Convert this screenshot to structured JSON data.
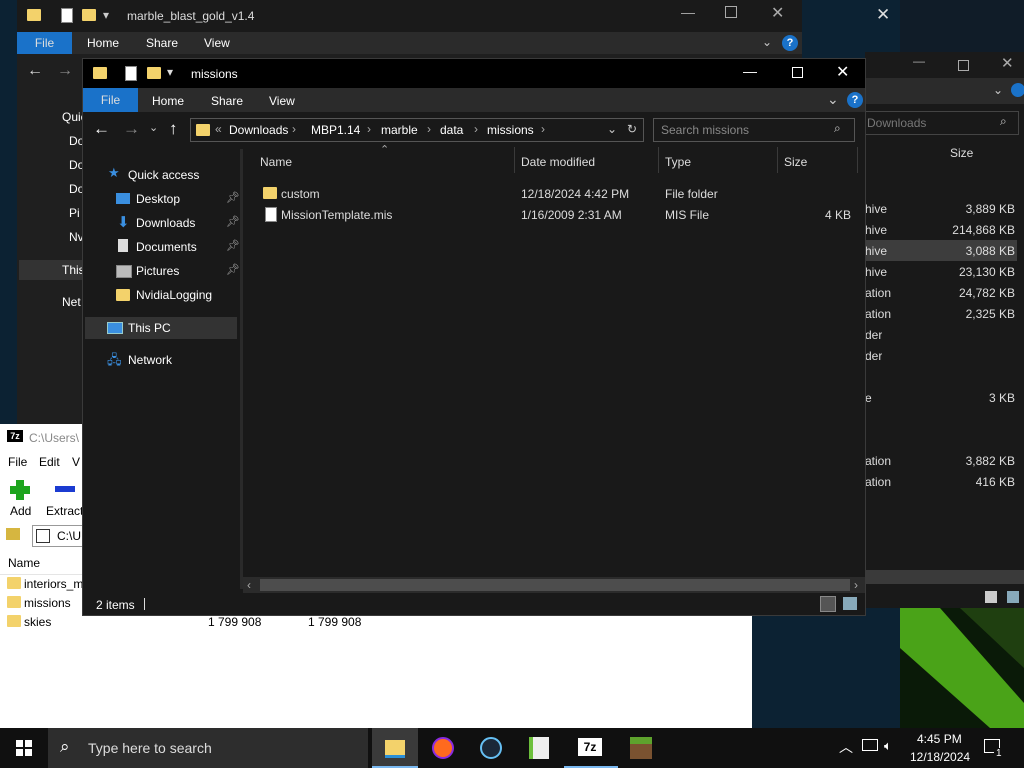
{
  "bg_explorer": {
    "title": "marble_blast_gold_v1.4",
    "ribbon": [
      "File",
      "Home",
      "Share",
      "View"
    ],
    "nav_partial": [
      "Quic",
      "Do",
      "Do",
      "Do",
      "Pi",
      "Nv",
      "This",
      "Net"
    ]
  },
  "right_explorer": {
    "search_placeholder": "Downloads",
    "size_header": "Size",
    "rows": [
      {
        "type": "hive",
        "size": "3,889 KB"
      },
      {
        "type": "hive",
        "size": "214,868 KB"
      },
      {
        "type": "hive",
        "size": "3,088 KB",
        "selected": true
      },
      {
        "type": "hive",
        "size": "23,130 KB"
      },
      {
        "type": "ation",
        "size": "24,782 KB"
      },
      {
        "type": "ation",
        "size": "2,325 KB"
      },
      {
        "type": "der",
        "size": ""
      },
      {
        "type": "der",
        "size": ""
      },
      {
        "type": "",
        "size": ""
      },
      {
        "type": "e",
        "size": "3 KB"
      },
      {
        "type": "",
        "size": ""
      },
      {
        "type": "",
        "size": ""
      },
      {
        "type": "ation",
        "size": "3,882 KB"
      },
      {
        "type": "ation",
        "size": "416 KB"
      }
    ]
  },
  "sevenzip": {
    "title": "C:\\Users\\",
    "menu": [
      "File",
      "Edit",
      "V"
    ],
    "add_label": "Add",
    "extract_label": "Extract",
    "path_partial": "C:\\U",
    "name_header": "Name",
    "rows": [
      {
        "name": "interiors_m",
        "size": "",
        "packed": ""
      },
      {
        "name": "missions",
        "size": "",
        "packed": ""
      },
      {
        "name": "skies",
        "size": "1 799 908",
        "packed": "1 799 908"
      }
    ]
  },
  "explorer": {
    "title": "missions",
    "ribbon": {
      "file": "File",
      "home": "Home",
      "share": "Share",
      "view": "View"
    },
    "breadcrumb": [
      "Downloads",
      "MBP1.14",
      "marble",
      "data",
      "missions"
    ],
    "search_placeholder": "Search missions",
    "nav": {
      "quick_access": "Quick access",
      "pinned": [
        "Desktop",
        "Downloads",
        "Documents",
        "Pictures"
      ],
      "nvidia": "NvidiaLogging",
      "this_pc": "This PC",
      "network": "Network"
    },
    "columns": {
      "name": "Name",
      "date": "Date modified",
      "type": "Type",
      "size": "Size"
    },
    "files": [
      {
        "name": "custom",
        "date": "12/18/2024 4:42 PM",
        "type": "File folder",
        "size": "",
        "icon": "folder-icon"
      },
      {
        "name": "MissionTemplate.mis",
        "date": "1/16/2009 2:31 AM",
        "type": "MIS File",
        "size": "4 KB",
        "icon": "file-icon"
      }
    ],
    "status": "2 items"
  },
  "taskbar": {
    "search_placeholder": "Type here to search",
    "time": "4:45 PM",
    "date": "12/18/2024",
    "notification_count": "1"
  }
}
